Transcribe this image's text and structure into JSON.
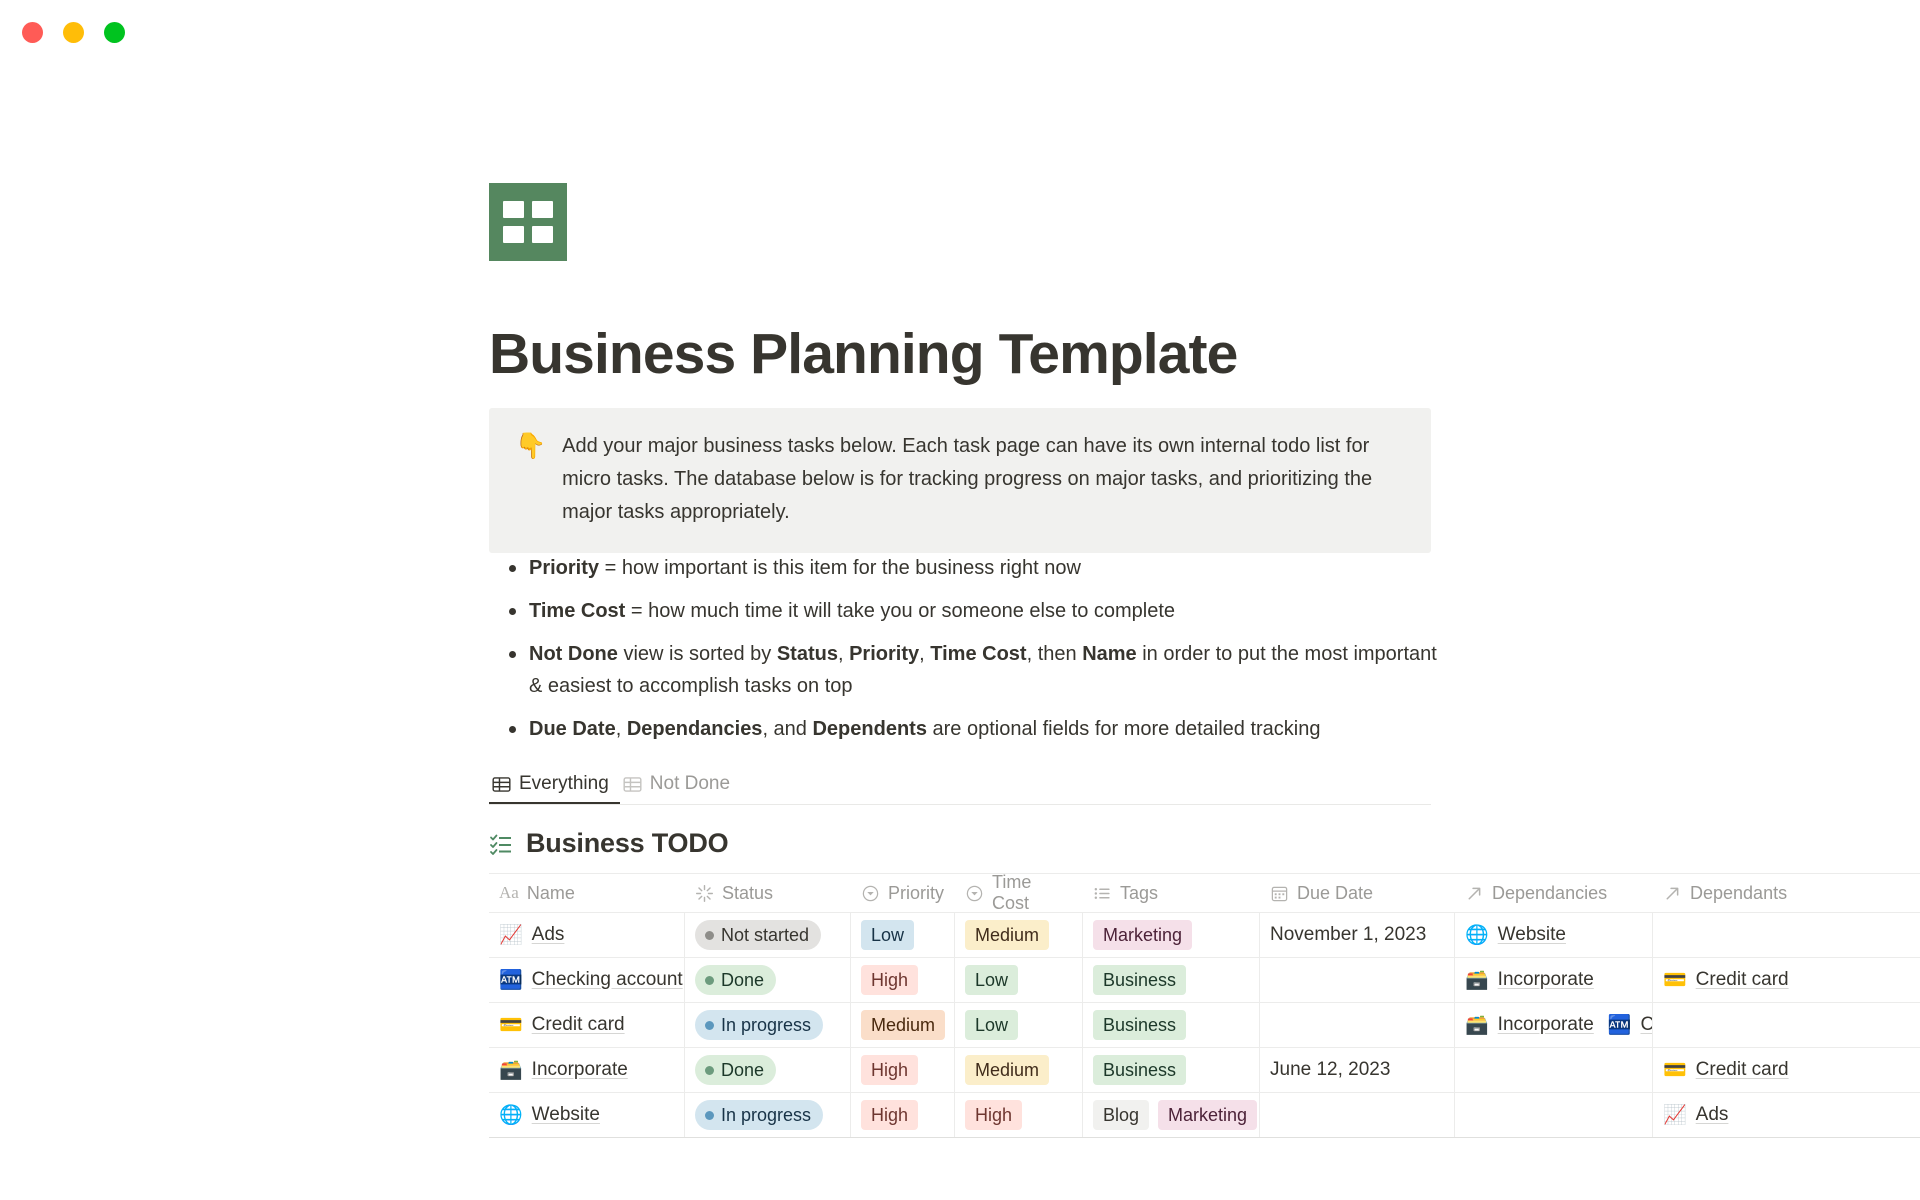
{
  "window": {
    "close_label": "close",
    "minimize_label": "minimize",
    "maximize_label": "maximize"
  },
  "page": {
    "icon": "green-spreadsheet-icon",
    "title": "Business Planning Template"
  },
  "callout": {
    "emoji": "👇",
    "text": "Add your major business tasks below. Each task page can have its own internal todo list for micro tasks. The database below is for tracking progress on major tasks, and prioritizing the major tasks appropriately."
  },
  "bullets": [
    {
      "segments": [
        {
          "text": "Priority",
          "bold": true
        },
        {
          "text": " = how important is this item for the business right now",
          "bold": false
        }
      ]
    },
    {
      "segments": [
        {
          "text": "Time Cost",
          "bold": true
        },
        {
          "text": " = how much time it will take you or someone else to complete",
          "bold": false
        }
      ]
    },
    {
      "segments": [
        {
          "text": "Not Done",
          "bold": true
        },
        {
          "text": " view is sorted by ",
          "bold": false
        },
        {
          "text": "Status",
          "bold": true
        },
        {
          "text": ", ",
          "bold": false
        },
        {
          "text": "Priority",
          "bold": true
        },
        {
          "text": ", ",
          "bold": false
        },
        {
          "text": "Time Cost",
          "bold": true
        },
        {
          "text": ", then ",
          "bold": false
        },
        {
          "text": "Name",
          "bold": true
        },
        {
          "text": " in order to put the most important & easiest to accomplish tasks on top",
          "bold": false
        }
      ]
    },
    {
      "segments": [
        {
          "text": "Due Date",
          "bold": true
        },
        {
          "text": ", ",
          "bold": false
        },
        {
          "text": "Dependancies",
          "bold": true
        },
        {
          "text": ", and ",
          "bold": false
        },
        {
          "text": "Dependents",
          "bold": true
        },
        {
          "text": " are optional fields for more detailed tracking",
          "bold": false
        }
      ]
    }
  ],
  "tabs": [
    {
      "label": "Everything",
      "icon": "table-grid-icon",
      "active": true
    },
    {
      "label": "Not Done",
      "icon": "table-grid-icon",
      "active": false
    }
  ],
  "database": {
    "icon": "checklist-icon",
    "title": "Business TODO",
    "columns": [
      {
        "key": "name",
        "label": "Name",
        "icon": "text-aa-icon"
      },
      {
        "key": "status",
        "label": "Status",
        "icon": "status-spinner-icon"
      },
      {
        "key": "prio",
        "label": "Priority",
        "icon": "select-circle-icon"
      },
      {
        "key": "time",
        "label": "Time Cost",
        "icon": "select-circle-icon"
      },
      {
        "key": "tags",
        "label": "Tags",
        "icon": "multiselect-list-icon"
      },
      {
        "key": "due",
        "label": "Due Date",
        "icon": "calendar-icon"
      },
      {
        "key": "dep",
        "label": "Dependancies",
        "icon": "relation-arrow-icon"
      },
      {
        "key": "dpt",
        "label": "Dependants",
        "icon": "relation-arrow-icon"
      }
    ],
    "rows": [
      {
        "name": {
          "emoji": "📈",
          "text": "Ads"
        },
        "status": {
          "label": "Not started",
          "dot": "#8e8d89",
          "bg": "#e3e2e0",
          "fg": "#37352f"
        },
        "priority": {
          "label": "Low",
          "bg": "#d3e5ef",
          "fg": "#183347"
        },
        "time_cost": {
          "label": "Medium",
          "bg": "#fbeeca",
          "fg": "#402c1b"
        },
        "tags": [
          {
            "label": "Marketing",
            "bg": "#f5e0e9",
            "fg": "#4c2238"
          }
        ],
        "due_date": "November 1, 2023",
        "dependancies": [
          {
            "emoji": "🌐",
            "text": "Website"
          }
        ],
        "dependants": []
      },
      {
        "name": {
          "emoji": "🏧",
          "text": "Checking account"
        },
        "status": {
          "label": "Done",
          "dot": "#6c9b7d",
          "bg": "#dbeddb",
          "fg": "#1c3829"
        },
        "priority": {
          "label": "High",
          "bg": "#ffe2dd",
          "fg": "#6e3630"
        },
        "time_cost": {
          "label": "Low",
          "bg": "#dbeddb",
          "fg": "#1c3829"
        },
        "tags": [
          {
            "label": "Business",
            "bg": "#dbeddb",
            "fg": "#1c3829"
          }
        ],
        "due_date": "",
        "dependancies": [
          {
            "emoji": "🗃️",
            "text": "Incorporate"
          }
        ],
        "dependants": [
          {
            "emoji": "💳",
            "text": "Credit card"
          }
        ]
      },
      {
        "name": {
          "emoji": "💳",
          "text": "Credit card"
        },
        "status": {
          "label": "In progress",
          "dot": "#5b97bd",
          "bg": "#d3e5ef",
          "fg": "#183347"
        },
        "priority": {
          "label": "Medium",
          "bg": "#fadec9",
          "fg": "#49290e"
        },
        "time_cost": {
          "label": "Low",
          "bg": "#dbeddb",
          "fg": "#1c3829"
        },
        "tags": [
          {
            "label": "Business",
            "bg": "#dbeddb",
            "fg": "#1c3829"
          }
        ],
        "due_date": "",
        "dependancies": [
          {
            "emoji": "🗃️",
            "text": "Incorporate"
          },
          {
            "emoji": "🏧",
            "text": "Checking account"
          }
        ],
        "dependants": []
      },
      {
        "name": {
          "emoji": "🗃️",
          "text": "Incorporate"
        },
        "status": {
          "label": "Done",
          "dot": "#6c9b7d",
          "bg": "#dbeddb",
          "fg": "#1c3829"
        },
        "priority": {
          "label": "High",
          "bg": "#ffe2dd",
          "fg": "#6e3630"
        },
        "time_cost": {
          "label": "Medium",
          "bg": "#fbeeca",
          "fg": "#402c1b"
        },
        "tags": [
          {
            "label": "Business",
            "bg": "#dbeddb",
            "fg": "#1c3829"
          }
        ],
        "due_date": "June 12, 2023",
        "dependancies": [],
        "dependants": [
          {
            "emoji": "💳",
            "text": "Credit card"
          }
        ]
      },
      {
        "name": {
          "emoji": "🌐",
          "text": "Website"
        },
        "status": {
          "label": "In progress",
          "dot": "#5b97bd",
          "bg": "#d3e5ef",
          "fg": "#183347"
        },
        "priority": {
          "label": "High",
          "bg": "#ffe2dd",
          "fg": "#6e3630"
        },
        "time_cost": {
          "label": "High",
          "bg": "#ffe2dd",
          "fg": "#6e3630"
        },
        "tags": [
          {
            "label": "Blog",
            "bg": "#f1f1ef",
            "fg": "#37352f"
          },
          {
            "label": "Marketing",
            "bg": "#f5e0e9",
            "fg": "#4c2238"
          }
        ],
        "due_date": "",
        "dependancies": [],
        "dependants": [
          {
            "emoji": "📈",
            "text": "Ads"
          }
        ]
      }
    ]
  },
  "colors": {
    "accent_green": "#55875f",
    "text": "#37352f",
    "muted": "#9b9a97",
    "border": "#ececeb",
    "callout_bg": "#f1f1ef"
  }
}
